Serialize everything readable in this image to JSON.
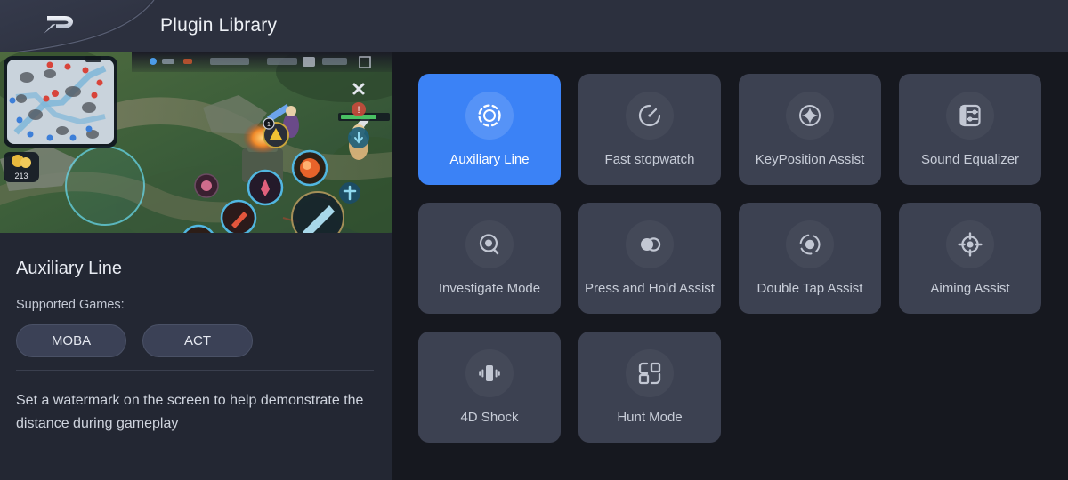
{
  "header": {
    "title": "Plugin Library",
    "logo_icon": "ldplayer-d-logo-icon",
    "background_color": "#2c303e"
  },
  "detail": {
    "preview_icon": "moba-game-screenshot",
    "title": "Auxiliary Line",
    "supported_games_label": "Supported Games:",
    "tags": [
      "MOBA",
      "ACT"
    ],
    "description": "Set a watermark on the screen to help demonstrate the distance during gameplay",
    "panel_color": "#232733"
  },
  "plugins": {
    "accent_color": "#3b82f6",
    "tile_color": "#3c4151",
    "items": [
      {
        "label": "Auxiliary Line",
        "icon": "dashed-ring-target-icon",
        "selected": true
      },
      {
        "label": "Fast stopwatch",
        "icon": "stopwatch-icon",
        "selected": false
      },
      {
        "label": "KeyPosition Assist",
        "icon": "four-point-star-circle-icon",
        "selected": false
      },
      {
        "label": "Sound Equalizer",
        "icon": "equalizer-sliders-icon",
        "selected": false
      },
      {
        "label": "Investigate Mode",
        "icon": "magnifier-dot-icon",
        "selected": false
      },
      {
        "label": "Press and Hold Assist",
        "icon": "two-overlapping-circles-icon",
        "selected": false
      },
      {
        "label": "Double Tap Assist",
        "icon": "double-tap-ring-icon",
        "selected": false
      },
      {
        "label": "Aiming Assist",
        "icon": "crosshair-target-icon",
        "selected": false
      },
      {
        "label": "4D Shock",
        "icon": "phone-vibrate-icon",
        "selected": false
      },
      {
        "label": "Hunt Mode",
        "icon": "four-squares-hook-icon",
        "selected": false
      }
    ]
  },
  "game_preview": {
    "minimap_label": "minimap",
    "gold_value": "213"
  }
}
